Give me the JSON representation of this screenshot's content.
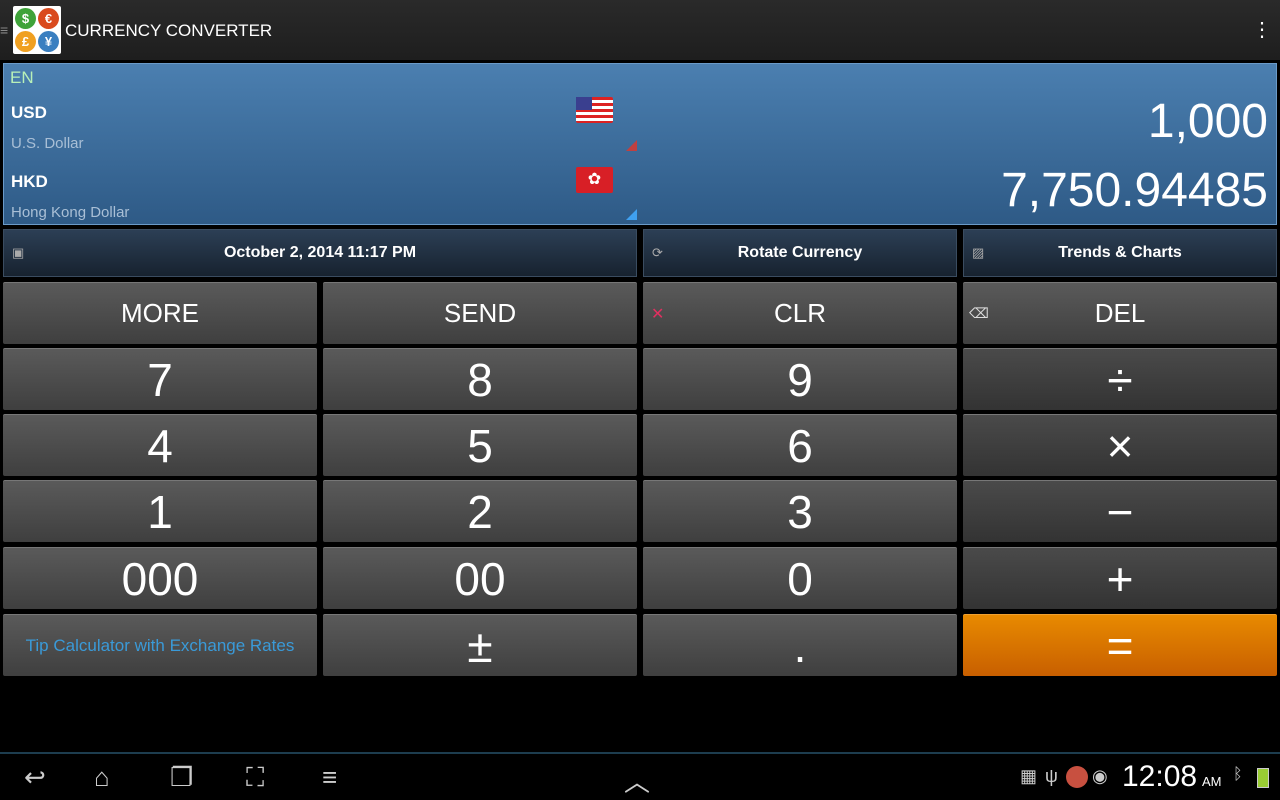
{
  "app": {
    "title": "CURRENCY CONVERTER",
    "logo_symbols": [
      "$",
      "€",
      "£",
      "¥"
    ]
  },
  "converter": {
    "language": "EN",
    "from": {
      "code": "USD",
      "name": "U.S. Dollar",
      "amount": "1,000",
      "flag": "us-flag"
    },
    "to": {
      "code": "HKD",
      "name": "Hong Kong Dollar",
      "amount": "7,750.94485",
      "flag": "hk-flag"
    }
  },
  "infobar": {
    "date": "October 2, 2014 11:17 PM",
    "rotate": "Rotate Currency",
    "trends": "Trends & Charts"
  },
  "keys": {
    "more": "MORE",
    "send": "SEND",
    "clr": "CLR",
    "del": "DEL",
    "rows": [
      [
        "7",
        "8",
        "9",
        "÷"
      ],
      [
        "4",
        "5",
        "6",
        "×"
      ],
      [
        "1",
        "2",
        "3",
        "−"
      ],
      [
        "000",
        "00",
        "0",
        "+"
      ]
    ],
    "tip": "Tip Calculator with Exchange Rates",
    "plusminus": "±",
    "dot": ".",
    "equals": "="
  },
  "colors": {
    "accent": "#e07b00",
    "panel": "#3d6c9c"
  },
  "statusbar": {
    "time": "12:08",
    "ampm": "AM"
  }
}
